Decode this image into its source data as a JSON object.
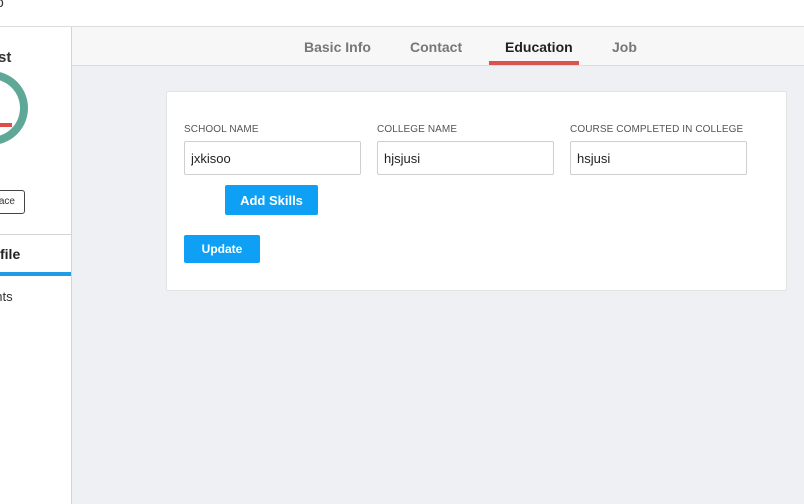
{
  "topbar": {
    "text": "o"
  },
  "sidebar": {
    "name_fragment": "st",
    "button_label": "ace",
    "items": [
      {
        "label": "rofile",
        "active": true
      },
      {
        "label": "ents",
        "active": false
      }
    ]
  },
  "tabs": [
    {
      "label": "Basic Info",
      "active": false
    },
    {
      "label": "Contact",
      "active": false
    },
    {
      "label": "Education",
      "active": true
    },
    {
      "label": "Job",
      "active": false
    }
  ],
  "form": {
    "fields": [
      {
        "label": "SCHOOL NAME",
        "value": "jxkisoo"
      },
      {
        "label": "COLLEGE NAME",
        "value": "hjsjusi"
      },
      {
        "label": "COURSE COMPLETED IN COLLEGE",
        "value": "hsjusi"
      }
    ],
    "add_skills_label": "Add Skills",
    "update_label": "Update"
  },
  "colors": {
    "accent_blue": "#0ea0f5",
    "tab_underline": "#d9534f",
    "avatar_ring": "#5fa898"
  }
}
